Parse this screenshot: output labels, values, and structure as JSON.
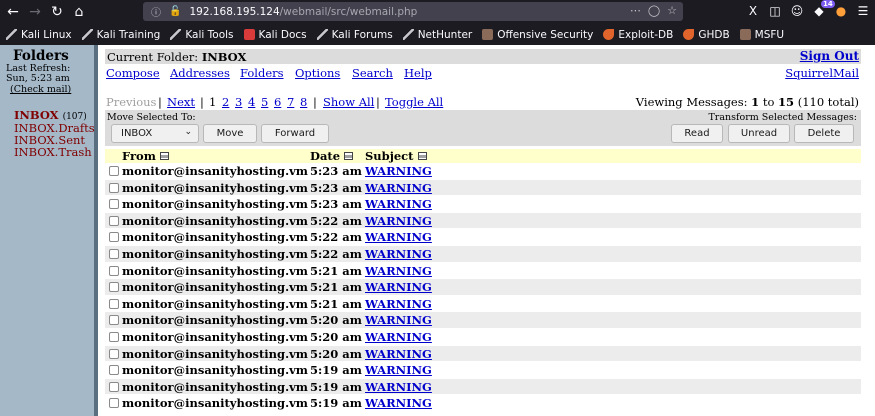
{
  "browser": {
    "url_host": "192.168.195.124",
    "url_path": "/webmail/src/webmail.php",
    "extensions_badge": "14"
  },
  "bookmarks": [
    {
      "label": "Kali Linux",
      "icon": "kali-dragon-icon"
    },
    {
      "label": "Kali Training",
      "icon": "kali-dragon-icon"
    },
    {
      "label": "Kali Tools",
      "icon": "kali-dragon-icon"
    },
    {
      "label": "Kali Docs",
      "icon": "kali-docs-icon"
    },
    {
      "label": "Kali Forums",
      "icon": "kali-dragon-icon"
    },
    {
      "label": "NetHunter",
      "icon": "nethunter-icon"
    },
    {
      "label": "Offensive Security",
      "icon": "offsec-icon"
    },
    {
      "label": "Exploit-DB",
      "icon": "exploit-db-icon"
    },
    {
      "label": "GHDB",
      "icon": "exploit-db-icon"
    },
    {
      "label": "MSFU",
      "icon": "offsec-icon"
    }
  ],
  "sidebar": {
    "title": "Folders",
    "last_refresh_label": "Last Refresh:",
    "refresh_time": "Sun, 5:23 am",
    "check_mail": "(Check mail)",
    "folders": [
      {
        "name": "INBOX",
        "count": "(107)"
      },
      {
        "name": "INBOX.Drafts"
      },
      {
        "name": "INBOX.Sent"
      },
      {
        "name": "INBOX.Trash"
      }
    ]
  },
  "header": {
    "current_folder_label": "Current Folder:",
    "current_folder": "INBOX",
    "sign_out": "Sign Out",
    "menu": [
      "Compose",
      "Addresses",
      "Folders",
      "Options",
      "Search",
      "Help"
    ],
    "brand_link": "SquirrelMail"
  },
  "pager": {
    "previous": "Previous",
    "next": "Next",
    "current_page": "1",
    "pages": [
      "2",
      "3",
      "4",
      "5",
      "6",
      "7",
      "8"
    ],
    "show_all": "Show All",
    "toggle_all": "Toggle All",
    "viewing_prefix": "Viewing Messages:",
    "viewing_from": "1",
    "viewing_to_word": "to",
    "viewing_to": "15",
    "viewing_total": "(110 total)"
  },
  "actions": {
    "move_label": "Move Selected To:",
    "folder_select_value": "INBOX",
    "move_button": "Move",
    "forward_button": "Forward",
    "transform_label": "Transform Selected Messages:",
    "read_button": "Read",
    "unread_button": "Unread",
    "delete_button": "Delete"
  },
  "table": {
    "columns": [
      "From",
      "Date",
      "Subject"
    ],
    "rows": [
      {
        "from": "monitor@insanityhosting.vm",
        "date": "5:23 am",
        "subject": "WARNING"
      },
      {
        "from": "monitor@insanityhosting.vm",
        "date": "5:23 am",
        "subject": "WARNING"
      },
      {
        "from": "monitor@insanityhosting.vm",
        "date": "5:23 am",
        "subject": "WARNING"
      },
      {
        "from": "monitor@insanityhosting.vm",
        "date": "5:22 am",
        "subject": "WARNING"
      },
      {
        "from": "monitor@insanityhosting.vm",
        "date": "5:22 am",
        "subject": "WARNING"
      },
      {
        "from": "monitor@insanityhosting.vm",
        "date": "5:22 am",
        "subject": "WARNING"
      },
      {
        "from": "monitor@insanityhosting.vm",
        "date": "5:21 am",
        "subject": "WARNING"
      },
      {
        "from": "monitor@insanityhosting.vm",
        "date": "5:21 am",
        "subject": "WARNING"
      },
      {
        "from": "monitor@insanityhosting.vm",
        "date": "5:21 am",
        "subject": "WARNING"
      },
      {
        "from": "monitor@insanityhosting.vm",
        "date": "5:20 am",
        "subject": "WARNING"
      },
      {
        "from": "monitor@insanityhosting.vm",
        "date": "5:20 am",
        "subject": "WARNING"
      },
      {
        "from": "monitor@insanityhosting.vm",
        "date": "5:20 am",
        "subject": "WARNING"
      },
      {
        "from": "monitor@insanityhosting.vm",
        "date": "5:19 am",
        "subject": "WARNING"
      },
      {
        "from": "monitor@insanityhosting.vm",
        "date": "5:19 am",
        "subject": "WARNING"
      },
      {
        "from": "monitor@insanityhosting.vm",
        "date": "5:19 am",
        "subject": "WARNING"
      }
    ]
  }
}
